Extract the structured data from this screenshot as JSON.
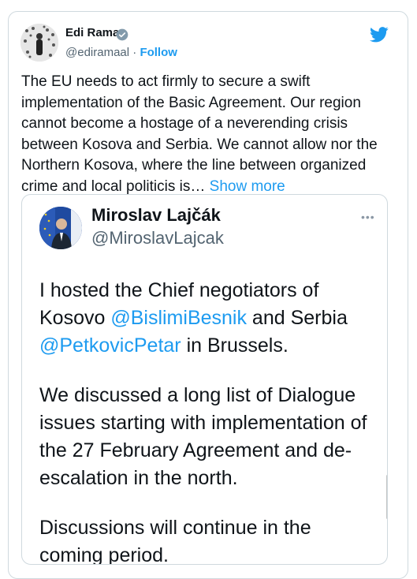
{
  "tweet": {
    "author_name": "Edi Rama",
    "author_handle": "@ediramaal",
    "separator": " · ",
    "follow_label": "Follow",
    "text": "The EU needs to act firmly to secure a swift implementation of the Basic Agreement. Our region cannot become a hostage of a neverending crisis between Kosova and Serbia. We cannot allow nor the Northern Kosova, where the line between organized crime and local politicis is…",
    "show_more_label": "Show more"
  },
  "embedded_tweet": {
    "author_name": "Miroslav Lajčák",
    "author_handle": "@MiroslavLajcak",
    "more_label": "•••",
    "para1_before": "I hosted the Chief negotiators of Kosovo ",
    "mention1": "@BislimiBesnik",
    "para1_mid": " and Serbia ",
    "mention2": "@PetkovicPetar",
    "para1_after": " in Brussels.",
    "para2": "We discussed a long list of Dialogue issues starting with implementation of the 27 February Agreement and de-escalation in the north.",
    "para3": "Discussions will continue in the coming period."
  },
  "colors": {
    "accent": "#1d9bf0",
    "text": "#0f1419",
    "muted": "#536471",
    "border": "#cfd9de"
  },
  "icons": [
    "avatar-photo",
    "verified-badge-icon",
    "twitter-bird-icon",
    "more-icon"
  ]
}
